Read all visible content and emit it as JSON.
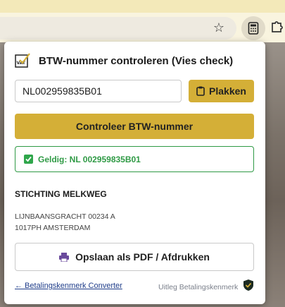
{
  "browser": {
    "bookmark_icon": "star-icon",
    "extension_icon": "calculator-icon",
    "extensions_menu_icon": "puzzle-icon"
  },
  "popup": {
    "title": "BTW-nummer controleren (Vies check)",
    "logo_text": "VAT",
    "vat_input_value": "NL002959835B01",
    "paste_label": "Plakken",
    "check_label": "Controleer BTW-nummer",
    "result_text": "Geldig: NL 002959835B01",
    "company_name": "STICHTING MELKWEG",
    "address_line1": "LIJNBAANSGRACHT 00234 A",
    "address_line2": "1017PH AMSTERDAM",
    "pdf_label": "Opslaan als PDF / Afdrukken",
    "back_link": "← Betalingskenmerk Converter",
    "info_link": "Uitleg Betalingskenmerk",
    "colors": {
      "accent": "#d4af37",
      "success": "#2f9a45",
      "link": "#1f3d8a"
    }
  }
}
